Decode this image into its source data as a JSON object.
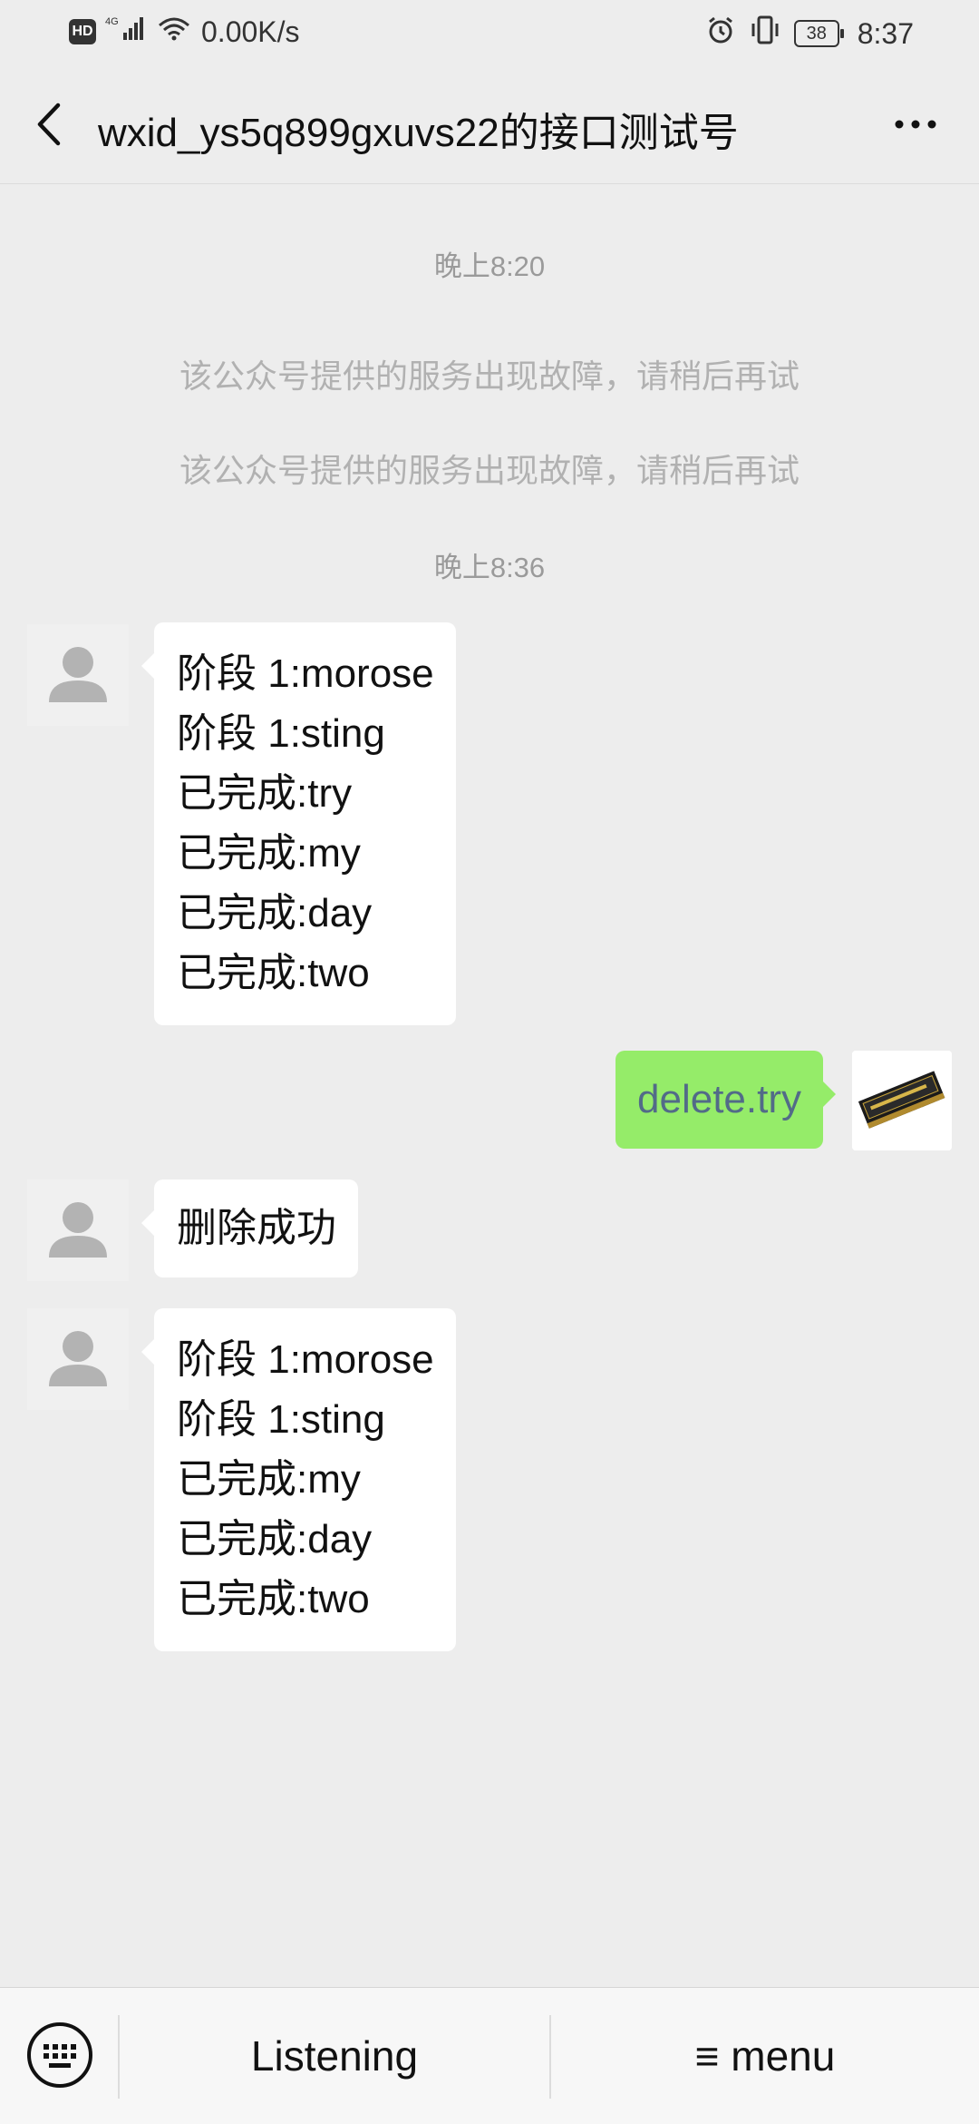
{
  "status_bar": {
    "network_speed": "0.00K/s",
    "battery": "38",
    "time": "8:37",
    "hd_label": "HD",
    "signal_label": "4G"
  },
  "header": {
    "title": "wxid_ys5q899gxuvs22的接口测试号",
    "back_icon": "chevron-left-icon",
    "more_icon": "more-dots-icon"
  },
  "chat": {
    "time_1": "晚上8:20",
    "system_1": "该公众号提供的服务出现故障，请稍后再试",
    "system_2": "该公众号提供的服务出现故障，请稍后再试",
    "time_2": "晚上8:36",
    "msg_1": [
      "阶段 1:morose",
      "阶段 1:sting",
      "已完成:try",
      "已完成:my",
      "已完成:day",
      "已完成:two"
    ],
    "my_msg": "delete.try",
    "msg_2": "删除成功",
    "msg_3": [
      "阶段 1:morose",
      "阶段 1:sting",
      "已完成:my",
      "已完成:day",
      "已完成:two"
    ]
  },
  "bottom_bar": {
    "keyboard_icon": "keyboard-icon",
    "listening_label": "Listening",
    "menu_label": "≡ menu"
  },
  "colors": {
    "background": "#ededed",
    "my_bubble": "#95ec69",
    "their_bubble": "#ffffff"
  }
}
